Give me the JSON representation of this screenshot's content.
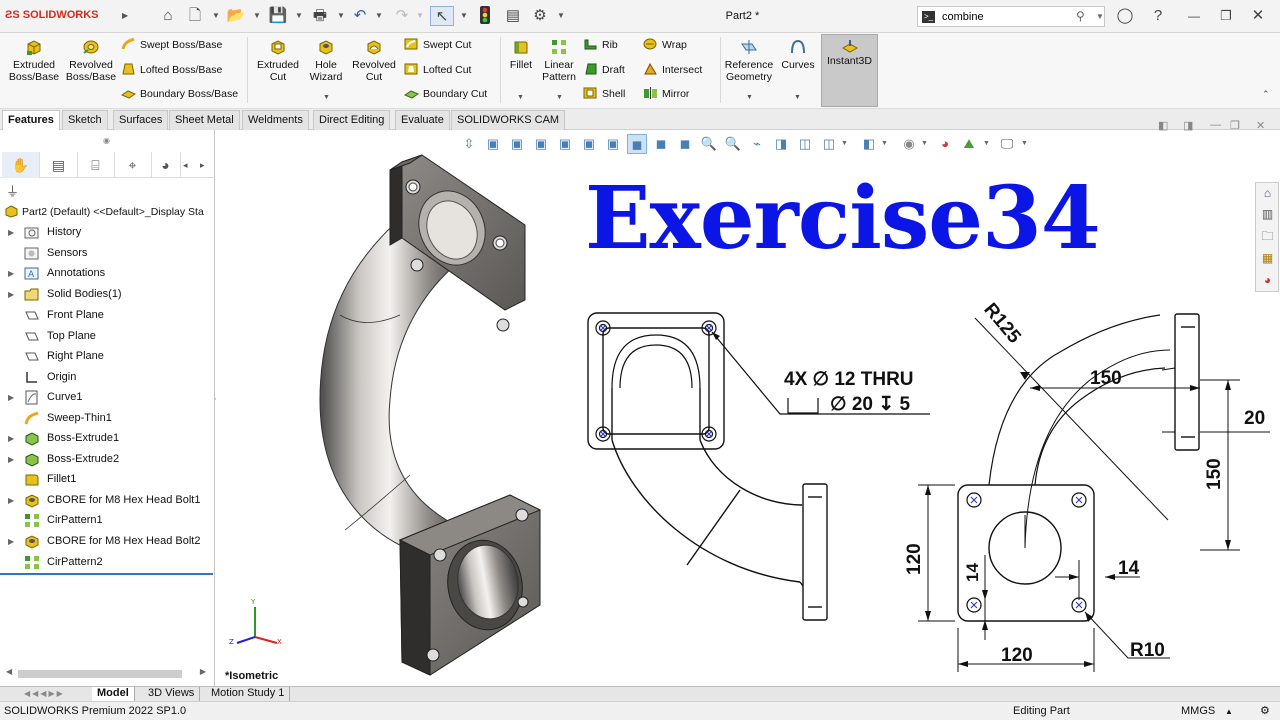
{
  "app": {
    "brand": "SOLIDWORKS",
    "document_title": "Part2 *"
  },
  "search": {
    "value": "combine"
  },
  "ribbon": {
    "extruded_boss": "Extruded Boss/Base",
    "revolved_boss": "Revolved Boss/Base",
    "swept_boss": "Swept Boss/Base",
    "lofted_boss": "Lofted Boss/Base",
    "boundary_boss": "Boundary Boss/Base",
    "extruded_cut": "Extruded Cut",
    "hole_wizard": "Hole Wizard",
    "revolved_cut": "Revolved Cut",
    "swept_cut": "Swept Cut",
    "lofted_cut": "Lofted Cut",
    "boundary_cut": "Boundary Cut",
    "fillet": "Fillet",
    "linear_pattern": "Linear Pattern",
    "rib": "Rib",
    "draft": "Draft",
    "shell": "Shell",
    "wrap": "Wrap",
    "intersect": "Intersect",
    "mirror": "Mirror",
    "reference_geometry": "Reference Geometry",
    "curves": "Curves",
    "instant3d": "Instant3D"
  },
  "tabs": [
    "Features",
    "Sketch",
    "Surfaces",
    "Sheet Metal",
    "Weldments",
    "Direct Editing",
    "Evaluate",
    "SOLIDWORKS CAM"
  ],
  "feature_manager": {
    "root": "Part2 (Default) <<Default>_Display Sta",
    "items": [
      {
        "label": "History"
      },
      {
        "label": "Sensors"
      },
      {
        "label": "Annotations"
      },
      {
        "label": "Solid Bodies(1)"
      },
      {
        "label": "Front Plane"
      },
      {
        "label": "Top Plane"
      },
      {
        "label": "Right Plane"
      },
      {
        "label": "Origin"
      },
      {
        "label": "Curve1"
      },
      {
        "label": "Sweep-Thin1"
      },
      {
        "label": "Boss-Extrude1"
      },
      {
        "label": "Boss-Extrude2"
      },
      {
        "label": "Fillet1"
      },
      {
        "label": "CBORE for M8 Hex Head Bolt1"
      },
      {
        "label": "CirPattern1"
      },
      {
        "label": "CBORE for M8 Hex Head Bolt2"
      },
      {
        "label": "CirPattern2"
      }
    ]
  },
  "viewport": {
    "view_label": "*Isometric",
    "exercise_title": "Exercise34"
  },
  "drawing": {
    "hole_callout_1": "4X ∅ 12 THRU",
    "hole_callout_2": "∅ 20 ↧ 5",
    "r125": "R125",
    "dim_150_h": "150",
    "dim_20": "20",
    "dim_150_v": "150",
    "dim_120_v": "120",
    "dim_14_v": "14",
    "dim_14_h": "14",
    "dim_120_h": "120",
    "r10": "R10"
  },
  "triad": {
    "y": "Y",
    "x": "X",
    "z": "Z"
  },
  "bottom_tabs": [
    "Model",
    "3D Views",
    "Motion Study 1"
  ],
  "status": {
    "product": "SOLIDWORKS Premium 2022 SP1.0",
    "mode": "Editing Part",
    "units": "MMGS"
  },
  "colors": {
    "title_blue": "#0a15e6",
    "brand_red": "#d52b1e",
    "icon_yellow": "#e8c21a",
    "icon_green": "#3c9a2c"
  }
}
